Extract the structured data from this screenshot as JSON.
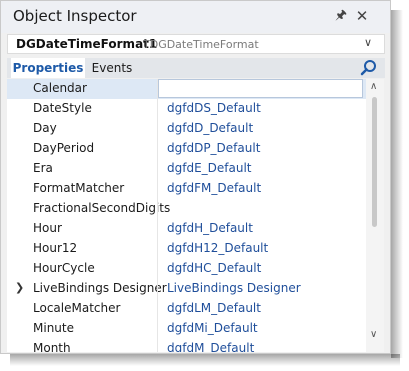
{
  "window": {
    "title": "Object Inspector"
  },
  "icons": {
    "pin": "pin-icon",
    "close": "close-icon",
    "search": "search-icon",
    "dropdown": "chevron-down-icon",
    "expander": "chevron-right-icon"
  },
  "selector": {
    "component_name": "DGDateTimeFormat1",
    "component_type": "TDGDateTimeFormat"
  },
  "tabs": [
    {
      "label": "Properties",
      "active": true
    },
    {
      "label": "Events",
      "active": false
    }
  ],
  "properties": [
    {
      "name": "Calendar",
      "value": "",
      "selected": true
    },
    {
      "name": "DateStyle",
      "value": "dgfdDS_Default"
    },
    {
      "name": "Day",
      "value": "dgfdD_Default"
    },
    {
      "name": "DayPeriod",
      "value": "dgfdDP_Default"
    },
    {
      "name": "Era",
      "value": "dgfdE_Default"
    },
    {
      "name": "FormatMatcher",
      "value": "dgfdFM_Default"
    },
    {
      "name": "FractionalSecondDigits",
      "value": ""
    },
    {
      "name": "Hour",
      "value": "dgfdH_Default"
    },
    {
      "name": "Hour12",
      "value": "dgfdH12_Default"
    },
    {
      "name": "HourCycle",
      "value": "dgfdHC_Default"
    },
    {
      "name": "LiveBindings Designer",
      "value": "LiveBindings Designer",
      "expandable": true
    },
    {
      "name": "LocaleMatcher",
      "value": "dgfdLM_Default"
    },
    {
      "name": "Minute",
      "value": "dgfdMi_Default"
    },
    {
      "name": "Month",
      "value": "dgfdM_Default"
    }
  ],
  "colors": {
    "accent": "#1e5aa8",
    "value_text": "#1f4e9a",
    "selected_row": "#dde8f5"
  }
}
